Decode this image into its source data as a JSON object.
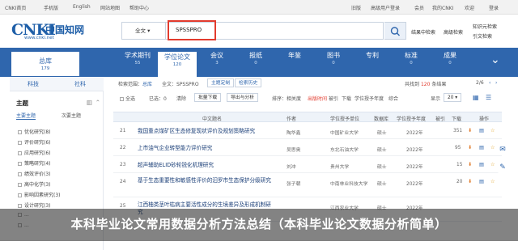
{
  "top_links": [
    "CNKI首页",
    "手机版",
    "English",
    "网站地图",
    "帮助中心",
    "旧版",
    "高级用户登录",
    "会员",
    "我的CNKI",
    "欢迎",
    "登录"
  ],
  "logo": {
    "brand": "CNKI",
    "cn": "中国知网",
    "url": "www.cnki.net"
  },
  "search": {
    "scope": "全文",
    "query": "SPSSPRO",
    "in_results": "结果中检索",
    "advanced": "高级检索",
    "vision": "知识元检索",
    "citation": "引文检索"
  },
  "nav": {
    "total": {
      "label": "总库",
      "count": "179"
    },
    "tabs": [
      {
        "label": "学术期刊",
        "count": "55"
      },
      {
        "label": "学位论文",
        "count": "120"
      },
      {
        "label": "会议",
        "count": "3"
      },
      {
        "label": "报纸",
        "count": "0"
      },
      {
        "label": "年鉴",
        "count": ""
      },
      {
        "label": "图书",
        "count": "0"
      },
      {
        "label": "专利",
        "count": ""
      },
      {
        "label": "标准",
        "count": "0"
      },
      {
        "label": "成果",
        "count": "0"
      }
    ]
  },
  "sidebar": {
    "tab_sci": "科技",
    "tab_soc": "社科",
    "topic": "主题",
    "sub_main": "主要主题",
    "sub_second": "次要主题",
    "items": [
      "优化研究(8)",
      "评价研究(6)",
      "应用研究(6)",
      "策略研究(4)",
      "绩效评价(3)",
      "高中化学(3)",
      "影响因素研究(3)",
      "设计研究(3)",
      "...",
      "..."
    ]
  },
  "main": {
    "crumb_label": "检索范围：",
    "crumb_scope": "总库",
    "crumb_query": "全文：SPSSPRO",
    "crumb_topic": "主题定制",
    "crumb_history": "检索历史",
    "result_prefix": "共找到",
    "result_count": "120",
    "result_suffix": "条结果",
    "page": "2/6",
    "select_all": "全选",
    "selected": "已选：0",
    "clear": "清除",
    "batch_download": "批量下载",
    "export": "导出与分析",
    "sort": "排序：",
    "sort_rel": "相关度",
    "sort_date": "出版时间",
    "sort_cite": "被引",
    "sort_dl": "下载",
    "sort_degree": "学位授予年度",
    "sort_combo": "综合",
    "display": "显示",
    "per_page": "20"
  },
  "table": {
    "headers": [
      "中文题名",
      "作者",
      "学位授予单位",
      "数据库",
      "学位授予年度",
      "被引",
      "下载",
      "操作"
    ],
    "rows": [
      {
        "no": "21",
        "title": "我国重点煤矿区生态修复现状评价及规划策略研究",
        "author": "陶华鑫",
        "unit": "中国矿业大学",
        "db": "硕士",
        "year": "2022年",
        "cite": "",
        "dl": "351"
      },
      {
        "no": "22",
        "title": "上市油气企业转型能力评价研究",
        "author": "吴思奥",
        "unit": "东北石油大学",
        "db": "硕士",
        "year": "2022年",
        "cite": "",
        "dl": "95"
      },
      {
        "no": "23",
        "title": "超声辅助ELID砂轮锐化机理研究",
        "author": "刘冲",
        "unit": "贵州大学",
        "db": "硕士",
        "year": "2022年",
        "cite": "",
        "dl": "15"
      },
      {
        "no": "24",
        "title": "基于生态重要性和敏感性评价的汩罗市生态保护分级研究",
        "author": "张子朝",
        "unit": "中南林业科技大学",
        "db": "硕士",
        "year": "2022年",
        "cite": "",
        "dl": "20"
      },
      {
        "no": "25",
        "title": "江西柚类茎叶枯病主要活性成分的生境差异及形成机制研究",
        "author": "",
        "unit": "江西农业大学",
        "db": "硕士",
        "year": "2022年",
        "cite": "",
        "dl": ""
      }
    ]
  },
  "banner": "本科毕业论文常用数据分析方法总结（本科毕业论文数据分析简单）",
  "colors": {
    "primary": "#2f66ad",
    "highlight": "#e23b2e",
    "download": "#e07b2b"
  }
}
